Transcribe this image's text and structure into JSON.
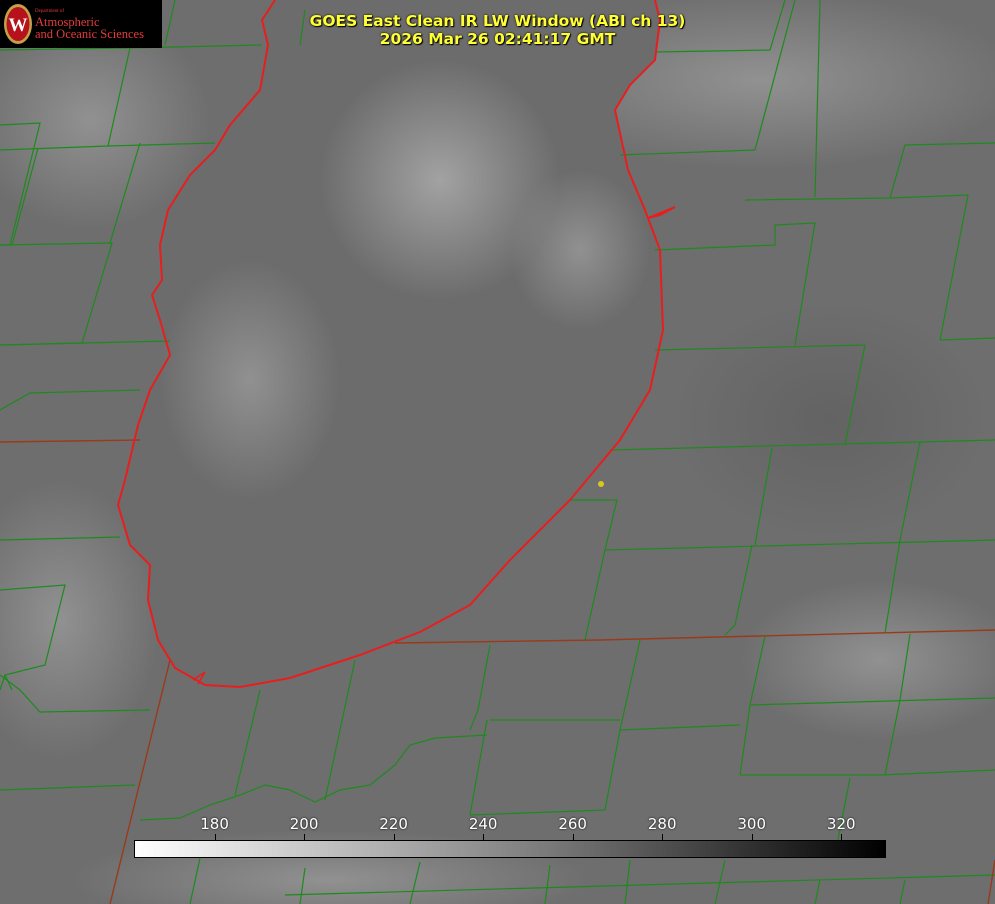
{
  "title": {
    "line1": "GOES East Clean IR LW Window (ABI ch 13)",
    "line2": "2026 Mar 26 02:41:17 GMT"
  },
  "logo": {
    "dept": "Department of",
    "line1": "Atmospheric",
    "line2": "and Oceanic Sciences",
    "seal_letter": "W"
  },
  "colorbar": {
    "min": 162,
    "max": 330,
    "ticks": [
      180,
      200,
      220,
      240,
      260,
      280,
      300,
      320
    ],
    "scale": "grayscale, warm = dark"
  },
  "colors": {
    "shoreline": "#e81e1e",
    "county_lines": "#1e8a1e",
    "title": "#ffff33",
    "marker": "#d7c81c"
  }
}
